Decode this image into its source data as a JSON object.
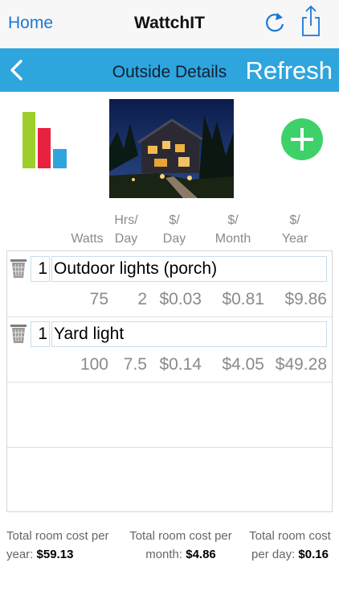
{
  "topbar": {
    "home_label": "Home",
    "app_title": "WattchIT",
    "refresh_icon": "refresh-icon",
    "share_icon": "share-icon",
    "link_color": "#1b77d6"
  },
  "navbar": {
    "back_icon": "chevron-left-icon",
    "title": "Outside Details",
    "refresh_label": "Refresh",
    "background": "#2fa5de"
  },
  "summary": {
    "chart_icon": "bar-chart-icon",
    "photo": "house-exterior-at-night",
    "add_icon": "plus-icon",
    "add_color": "#3ed16a"
  },
  "columns": {
    "watts": "Watts",
    "hrs_top": "Hrs/",
    "hrs_bottom": "Day",
    "day_top": "$/",
    "day_bottom": "Day",
    "month_top": "$/",
    "month_bottom": "Month",
    "year_top": "$/",
    "year_bottom": "Year"
  },
  "devices": [
    {
      "qty": "1",
      "name": "Outdoor lights (porch)",
      "watts": "75",
      "hrs_per_day": "2",
      "cost_day": "$0.03",
      "cost_month": "$0.81",
      "cost_year": "$9.86"
    },
    {
      "qty": "1",
      "name": "Yard light",
      "watts": "100",
      "hrs_per_day": "7.5",
      "cost_day": "$0.14",
      "cost_month": "$4.05",
      "cost_year": "$49.28"
    }
  ],
  "totals": {
    "year_label_1": "Total room cost per",
    "year_label_2": "year:",
    "year_value": "$59.13",
    "month_label_1": "Total room cost per",
    "month_label_2": "month:",
    "month_value": "$4.86",
    "day_label_1": "Total room cost",
    "day_label_2": "per day:",
    "day_value": "$0.16"
  }
}
